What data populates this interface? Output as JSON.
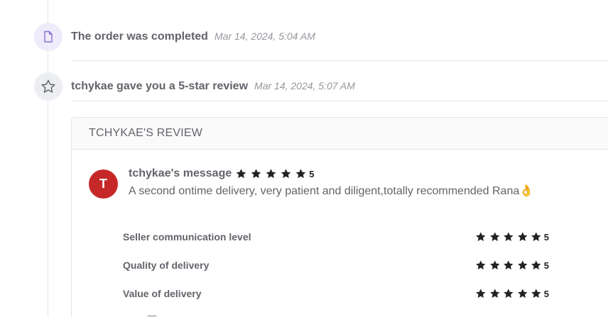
{
  "timeline": [
    {
      "icon": "document-icon",
      "title": "The order was completed",
      "time": "Mar 14, 2024, 5:04 AM"
    },
    {
      "icon": "star-icon",
      "title": "tchykae gave you a 5-star review",
      "time": "Mar 14, 2024, 5:07 AM"
    }
  ],
  "review": {
    "heading": "TCHYKAE'S REVIEW",
    "avatar_initial": "T",
    "avatar_color": "#c62828",
    "author_label": "tchykae's message",
    "rating": "5",
    "message": "A second ontime delivery, very patient and diligent,totally recommended Rana👌",
    "criteria": [
      {
        "label": "Seller communication level",
        "rating": "5"
      },
      {
        "label": "Quality of delivery",
        "rating": "5"
      },
      {
        "label": "Value of delivery",
        "rating": "5"
      }
    ]
  },
  "colors": {
    "accent_purple": "#8a6fd1",
    "star": "#222325",
    "text_muted": "#95979d"
  }
}
